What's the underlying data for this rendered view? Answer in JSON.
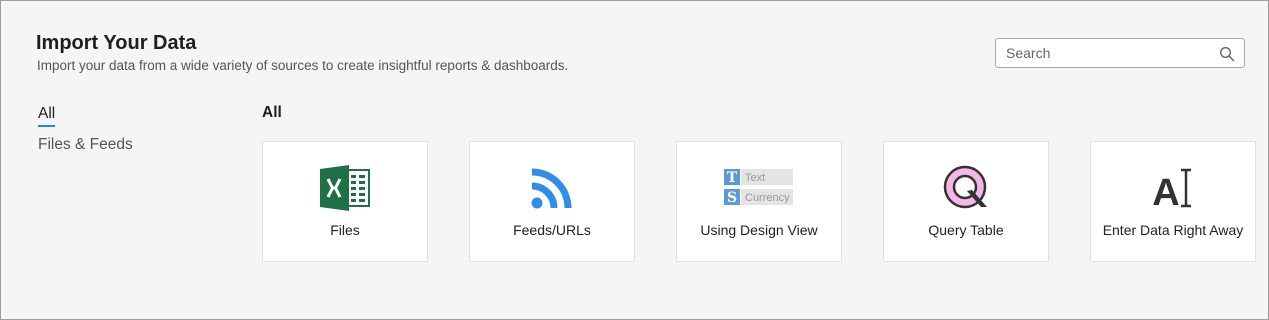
{
  "header": {
    "title": "Import Your Data",
    "subtitle": "Import your data from a wide variety of sources to create insightful reports & dashboards."
  },
  "search": {
    "placeholder": "Search",
    "value": "",
    "icon": "search-icon"
  },
  "sidebar": {
    "items": [
      {
        "label": "All",
        "active": true
      },
      {
        "label": "Files & Feeds",
        "active": false
      }
    ]
  },
  "main": {
    "section_title": "All",
    "cards": [
      {
        "label": "Files",
        "icon": "excel-icon"
      },
      {
        "label": "Feeds/URLs",
        "icon": "rss-feed-icon"
      },
      {
        "label": "Using Design View",
        "icon": "design-view-icon",
        "icon_text": {
          "t_letter": "T",
          "t_word": "Text",
          "s_letter": "S",
          "s_word": "Currency"
        }
      },
      {
        "label": "Query Table",
        "icon": "query-table-icon"
      },
      {
        "label": "Enter Data Right Away",
        "icon": "text-cursor-icon",
        "icon_letter": "A"
      }
    ]
  },
  "colors": {
    "accent": "#1e88e5",
    "excel_green": "#1e7145",
    "rss_blue": "#2f8fe8",
    "query_pink": "#f5b8e6"
  }
}
